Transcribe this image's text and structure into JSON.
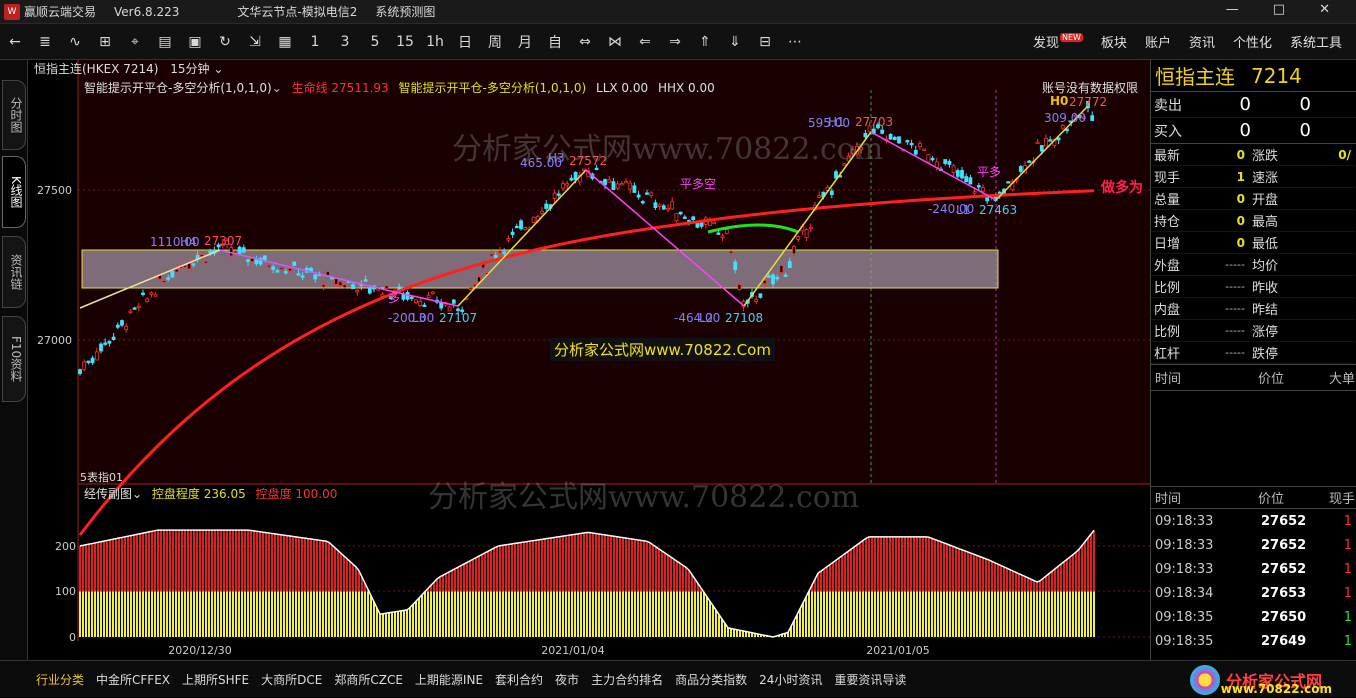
{
  "titlebar": {
    "app": "赢顺云端交易",
    "version": "Ver6.8.223",
    "server": "文华云节点-模拟电信2",
    "menu": "系统预测图",
    "buttons": [
      "—",
      "□",
      "✕"
    ]
  },
  "toolbar": {
    "items": [
      "←",
      "≣",
      "∿",
      "⊞",
      "⌖",
      "▤",
      "▣",
      "↻",
      "⇲",
      "▦",
      "1",
      "3",
      "5",
      "15",
      "1h",
      "日",
      "周",
      "月",
      "自",
      "⇔",
      "⋈",
      "⇐",
      "⇒",
      "⇑",
      "⇓",
      "⊟",
      "⋯"
    ],
    "right": [
      {
        "label": "发现",
        "badge": "NEW"
      },
      {
        "label": "板块"
      },
      {
        "label": "账户"
      },
      {
        "label": "资讯"
      },
      {
        "label": "个性化"
      },
      {
        "label": "系统工具"
      }
    ]
  },
  "lefttabs": [
    "分时图",
    "K线图",
    "资讯链",
    "F10资料"
  ],
  "chart": {
    "symbol": "恒指主连(HKEX 7214)",
    "period": "15分钟",
    "ind_name": "智能提示开平仓-多空分析(1,0,1,0)",
    "life_label": "生命线",
    "life_value": "27511.93",
    "ind_name2": "智能提示开平仓-多空分析(1,0,1,0)",
    "llx": "LLX 0.00",
    "hhx": "HHX 0.00",
    "no_data": "账号没有数据权限",
    "sub_name": "经传副图",
    "sub_label1": "控盘程度",
    "sub_value1": "236.05",
    "sub_label2": "控盘度",
    "sub_value2": "100.00",
    "bottom_label": "5表指01",
    "watermark_center": "分析家公式网www.70822.Com"
  },
  "right": {
    "name": "恒指主连",
    "code": "7214",
    "ask_label": "卖出",
    "ask": "0",
    "ask_vol": "0",
    "bid_label": "买入",
    "bid": "0",
    "bid_vol": "0",
    "grid": [
      [
        "最新",
        "0",
        "涨跌",
        "0/"
      ],
      [
        "现手",
        "1",
        "速涨",
        ""
      ],
      [
        "总量",
        "0",
        "开盘",
        ""
      ],
      [
        "持仓",
        "0",
        "最高",
        ""
      ],
      [
        "日增",
        "0",
        "最低",
        ""
      ],
      [
        "外盘",
        "-----",
        "均价",
        ""
      ],
      [
        "比例",
        "-----",
        "昨收",
        ""
      ],
      [
        "内盘",
        "-----",
        "昨结",
        ""
      ],
      [
        "比例",
        "-----",
        "涨停",
        ""
      ],
      [
        "杠杆",
        "-----",
        "跌停",
        ""
      ]
    ],
    "sec1": [
      "时间",
      "价位",
      "大单"
    ],
    "sec2": [
      "时间",
      "价位",
      "现手"
    ],
    "ticks": [
      [
        "09:18:33",
        "27652",
        "1"
      ],
      [
        "09:18:33",
        "27652",
        "1"
      ],
      [
        "09:18:33",
        "27652",
        "1"
      ],
      [
        "09:18:34",
        "27653",
        "1"
      ],
      [
        "09:18:35",
        "27650",
        "1"
      ],
      [
        "09:18:35",
        "27649",
        "1"
      ]
    ]
  },
  "bottombar": [
    "行业分类",
    "中金所CFFEX",
    "上期所SHFE",
    "大商所DCE",
    "郑商所CZCE",
    "上期能源INE",
    "套利合约",
    "夜市",
    "主力合约排名",
    "商品分类指数",
    "24小时资讯",
    "重要资讯导读"
  ],
  "brand": {
    "name": "分析家公式网",
    "site": "www.70822.com"
  },
  "chart_data": {
    "type": "candlestick",
    "yticks": [
      "27500",
      "27000"
    ],
    "sub_yticks": [
      "200",
      "100",
      "0"
    ],
    "xticks": [
      "2020/12/30",
      "2021/01/04",
      "2021/01/05"
    ],
    "annotations": [
      {
        "text": "1110.00",
        "color": "#8080ff"
      },
      {
        "text": "H4",
        "color": "#8080ff"
      },
      {
        "text": "27307",
        "color": "#ff5050"
      },
      {
        "text": "465.00",
        "color": "#8080ff"
      },
      {
        "text": "H3",
        "color": "#8080ff"
      },
      {
        "text": "27572",
        "color": "#ff5050"
      },
      {
        "text": "595.00",
        "color": "#8080ff"
      },
      {
        "text": "H1",
        "color": "#8080ff"
      },
      {
        "text": "27703",
        "color": "#ff5050"
      },
      {
        "text": "-200.00",
        "color": "#8080ff"
      },
      {
        "text": "L3",
        "color": "#8080ff"
      },
      {
        "text": "27107",
        "color": "#40d0ff"
      },
      {
        "text": "-464.00",
        "color": "#8080ff"
      },
      {
        "text": "L2",
        "color": "#8080ff"
      },
      {
        "text": "27108",
        "color": "#40d0ff"
      },
      {
        "text": "-240.00",
        "color": "#8080ff"
      },
      {
        "text": "L1",
        "color": "#8080ff"
      },
      {
        "text": "27463",
        "color": "#40d0ff"
      },
      {
        "text": "309.00",
        "color": "#8080ff"
      },
      {
        "text": "H0",
        "color": "#f0c000"
      },
      {
        "text": "27772",
        "color": "#ff5050"
      },
      {
        "text": "平多空",
        "color": "#ff40ff"
      },
      {
        "text": "平多",
        "color": "#ff40ff"
      },
      {
        "text": "多",
        "color": "#ff40ff"
      },
      {
        "text": "做多为",
        "color": "#ff2050"
      }
    ]
  }
}
